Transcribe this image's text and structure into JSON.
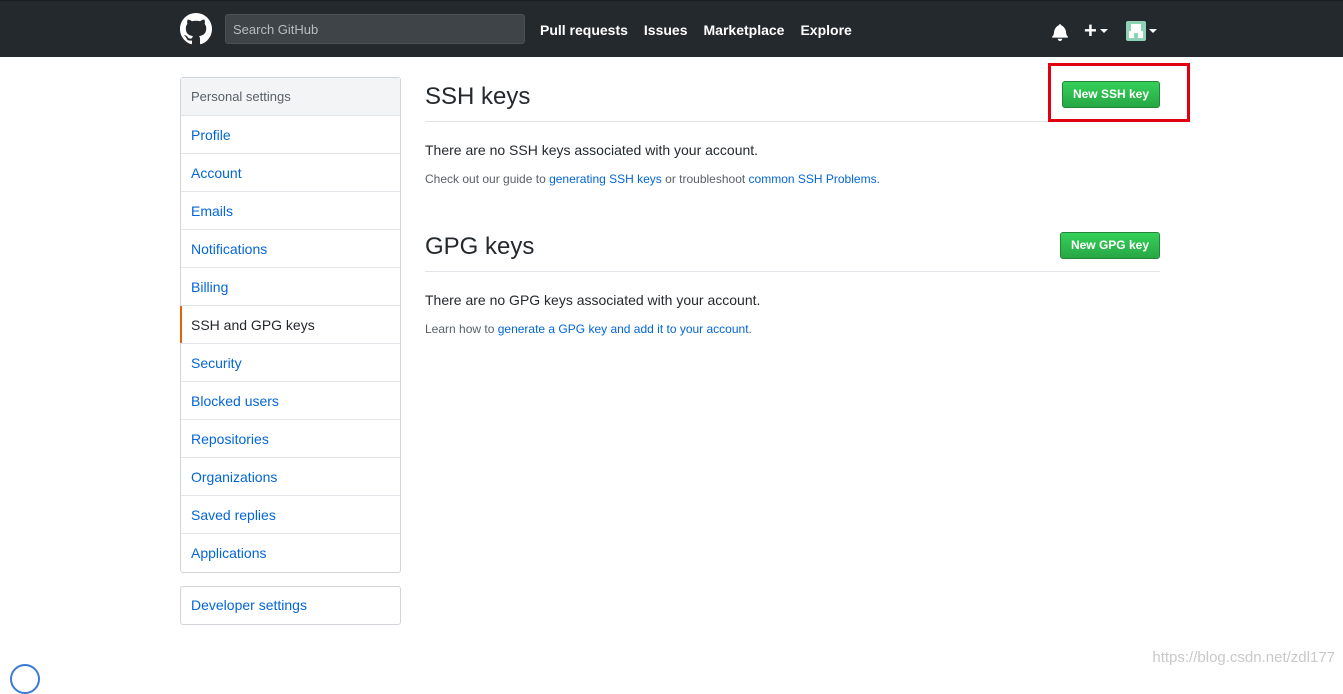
{
  "header": {
    "search_placeholder": "Search GitHub",
    "nav": [
      "Pull requests",
      "Issues",
      "Marketplace",
      "Explore"
    ],
    "plus_symbol": "+"
  },
  "sidebar": {
    "heading": "Personal settings",
    "items": [
      {
        "label": "Profile"
      },
      {
        "label": "Account"
      },
      {
        "label": "Emails"
      },
      {
        "label": "Notifications"
      },
      {
        "label": "Billing"
      },
      {
        "label": "SSH and GPG keys",
        "selected": true
      },
      {
        "label": "Security"
      },
      {
        "label": "Blocked users"
      },
      {
        "label": "Repositories"
      },
      {
        "label": "Organizations"
      },
      {
        "label": "Saved replies"
      },
      {
        "label": "Applications"
      }
    ],
    "developer": "Developer settings"
  },
  "ssh": {
    "title": "SSH keys",
    "button": "New SSH key",
    "blank": "There are no SSH keys associated with your account.",
    "note_prefix": "Check out our guide to ",
    "note_link1": "generating SSH keys",
    "note_middle": " or troubleshoot ",
    "note_link2": "common SSH Problems",
    "note_suffix": "."
  },
  "gpg": {
    "title": "GPG keys",
    "button": "New GPG key",
    "blank": "There are no GPG keys associated with your account.",
    "note_prefix": "Learn how to ",
    "note_link": "generate a GPG key and add it to your account",
    "note_suffix": "."
  },
  "watermark": "https://blog.csdn.net/zdl177",
  "colors": {
    "header_bg": "#24292e",
    "link": "#0366d6",
    "selected_accent": "#e36209",
    "button_green": "#28a745",
    "highlight_red": "#e1000f"
  }
}
